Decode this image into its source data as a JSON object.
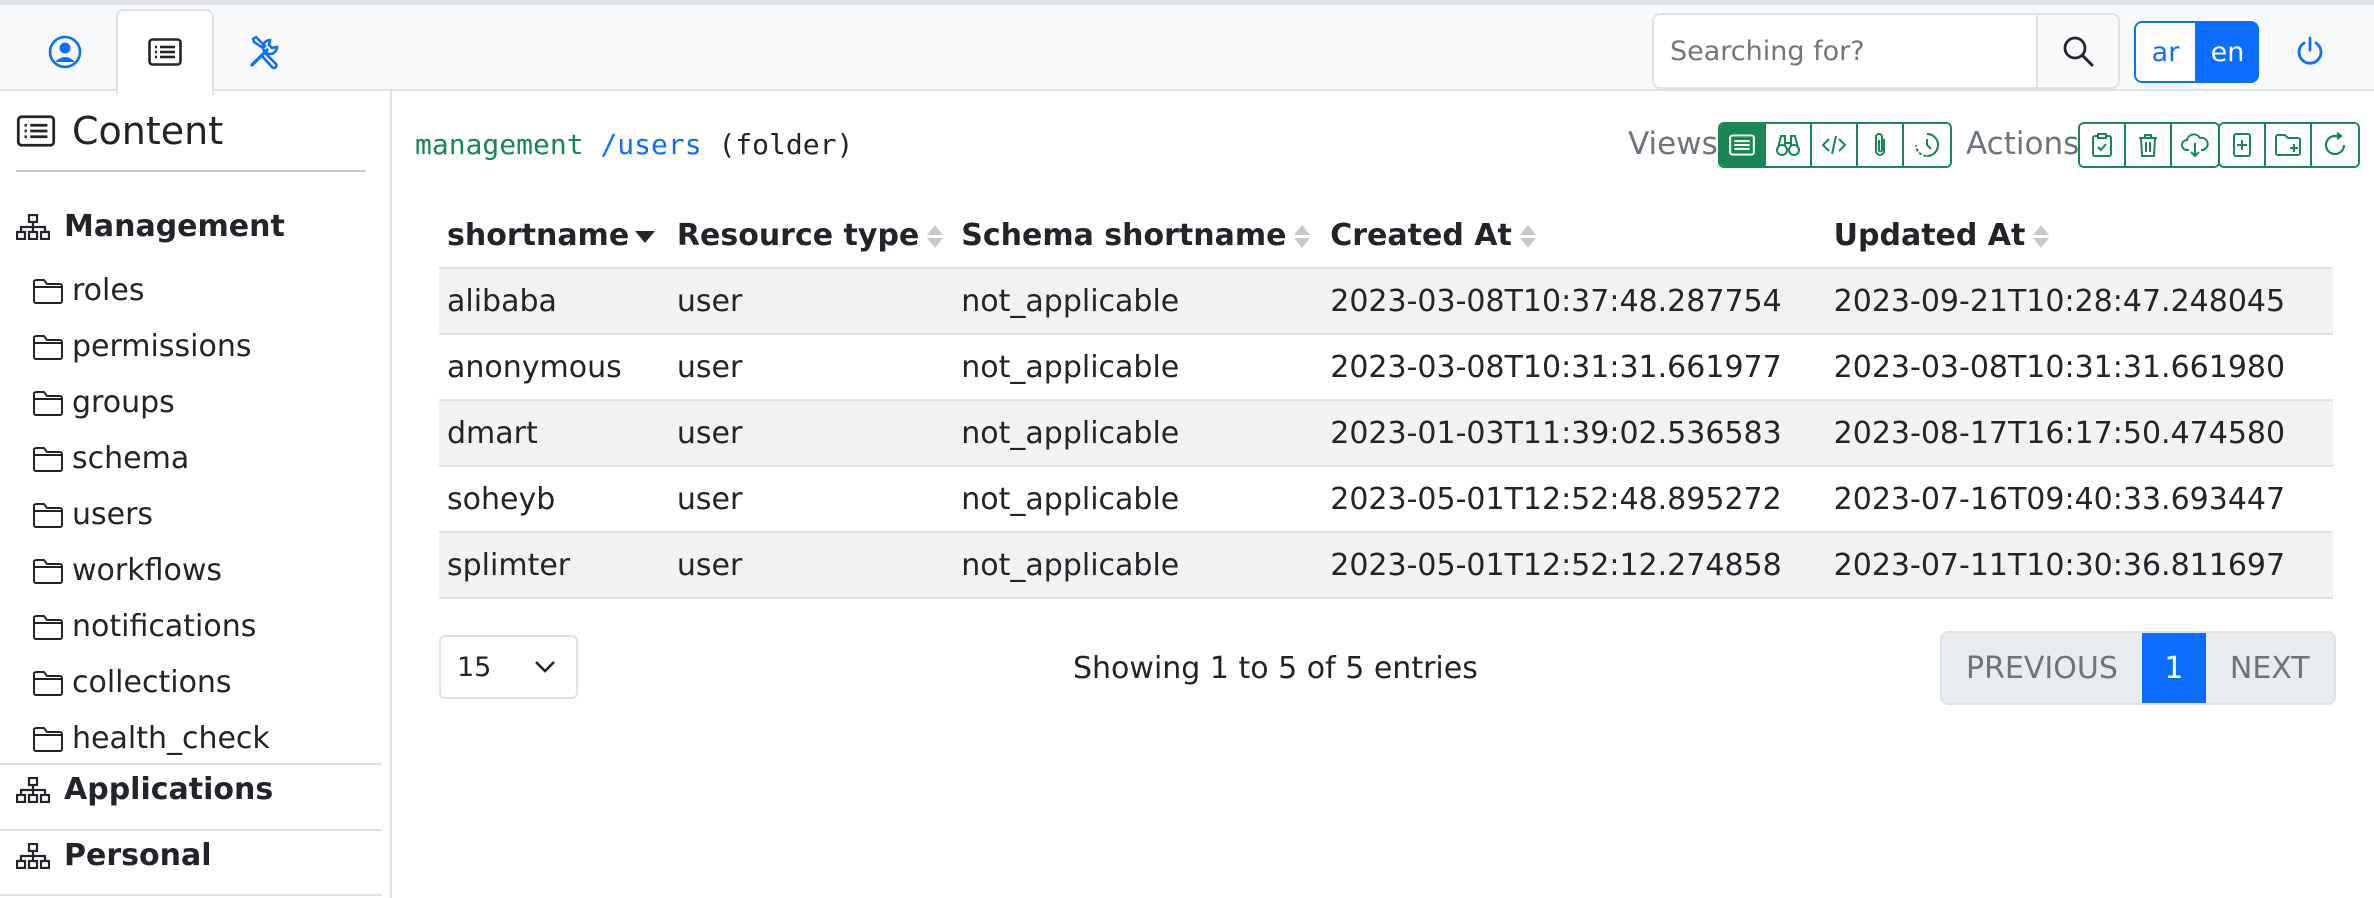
{
  "search": {
    "placeholder": "Searching for?"
  },
  "lang": {
    "ar": "ar",
    "en": "en"
  },
  "sidebar": {
    "heading": "Content",
    "sections": [
      "Management",
      "Applications",
      "Personal"
    ],
    "folders": [
      "roles",
      "permissions",
      "groups",
      "schema",
      "users",
      "workflows",
      "notifications",
      "collections",
      "health_check"
    ]
  },
  "breadcrumb": {
    "space": "management",
    "path": "/users",
    "type": "(folder)"
  },
  "toolbar": {
    "views_label": "Views",
    "actions_label": "Actions"
  },
  "table": {
    "columns": [
      "shortname",
      "Resource type",
      "Schema shortname",
      "Created At",
      "Updated At"
    ],
    "rows": [
      [
        "alibaba",
        "user",
        "not_applicable",
        "2023-03-08T10:37:48.287754",
        "2023-09-21T10:28:47.248045"
      ],
      [
        "anonymous",
        "user",
        "not_applicable",
        "2023-03-08T10:31:31.661977",
        "2023-03-08T10:31:31.661980"
      ],
      [
        "dmart",
        "user",
        "not_applicable",
        "2023-01-03T11:39:02.536583",
        "2023-08-17T16:17:50.474580"
      ],
      [
        "soheyb",
        "user",
        "not_applicable",
        "2023-05-01T12:52:48.895272",
        "2023-07-16T09:40:33.693447"
      ],
      [
        "splimter",
        "user",
        "not_applicable",
        "2023-05-01T12:52:12.274858",
        "2023-07-11T10:30:36.811697"
      ]
    ]
  },
  "pagination": {
    "page_size": "15",
    "info": "Showing 1 to 5 of 5 entries",
    "prev": "PREVIOUS",
    "current": "1",
    "next": "NEXT"
  },
  "colors": {
    "primary": "#0d6efd",
    "success": "#198754",
    "border": "#dee2e6",
    "muted": "#6c757d"
  }
}
